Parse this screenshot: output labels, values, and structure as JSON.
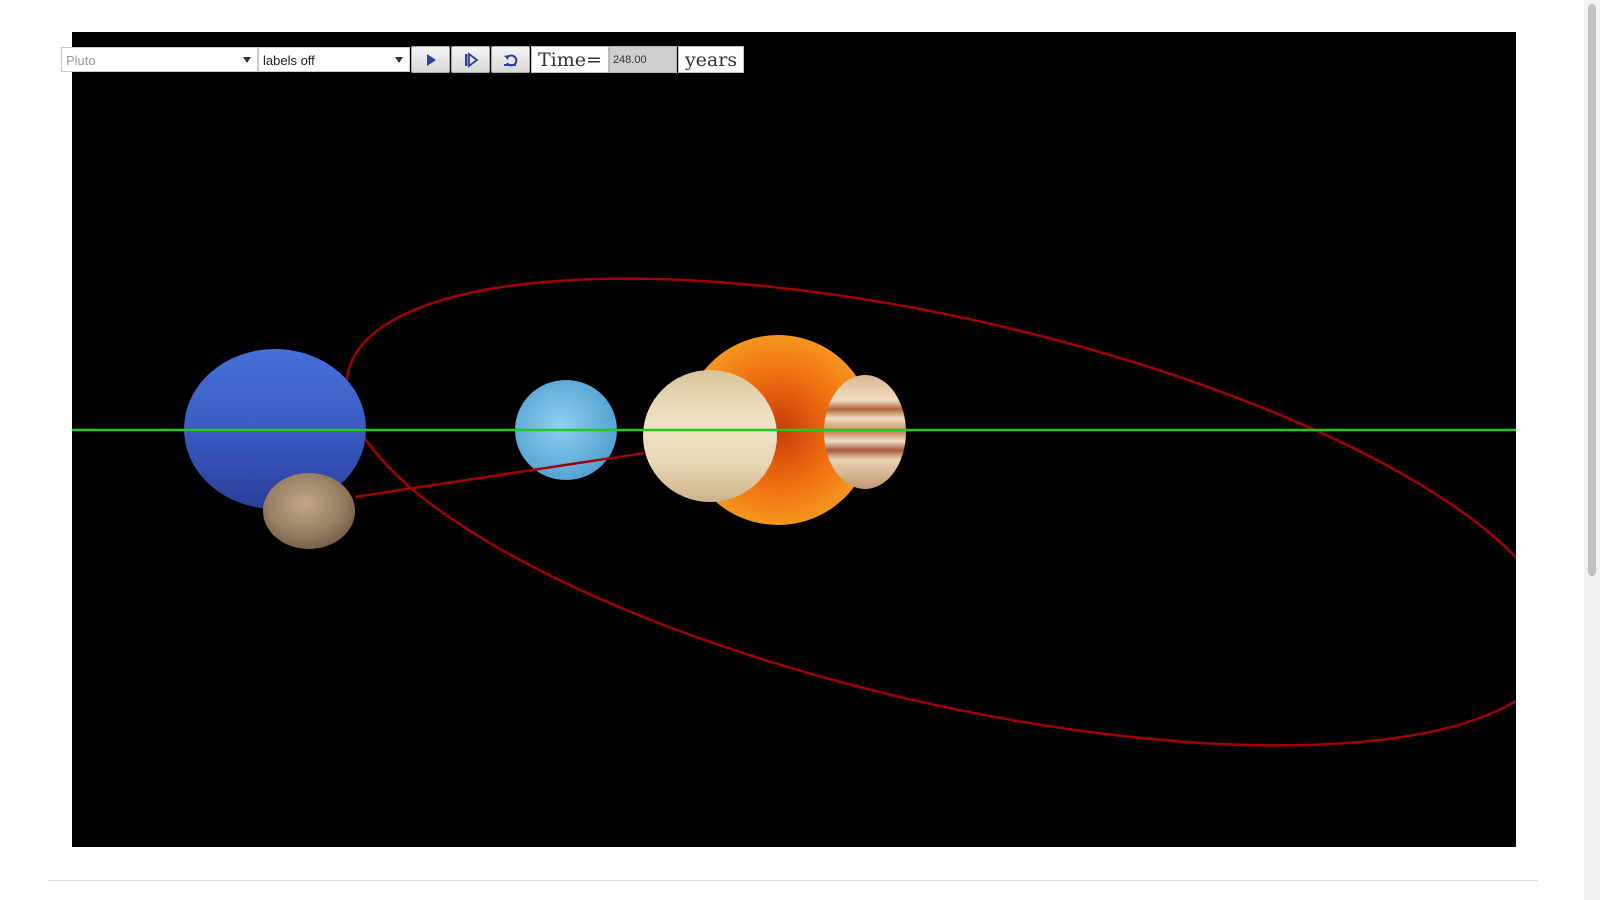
{
  "toolbar": {
    "body_select": {
      "value": "Pluto"
    },
    "labels_select": {
      "value": "labels off"
    },
    "play_button": {
      "icon": "play-icon"
    },
    "step_button": {
      "icon": "step-forward-icon"
    },
    "reset_button": {
      "icon": "reset-icon"
    },
    "time_label": "Time=",
    "time_value": "248.00",
    "time_unit": "years"
  },
  "scene": {
    "background": "#000000",
    "colors": {
      "ecliptic_line": "#22c81e",
      "pluto_orbit": "#a00000",
      "sun": "#f06a0a",
      "neptune": "#3d5fc8",
      "uranus": "#6bbde6",
      "saturn": "#e6d6b2",
      "jupiter": "#c8905a",
      "pluto": "#9a8064"
    },
    "bodies": [
      "sun",
      "neptune",
      "uranus",
      "saturn",
      "jupiter",
      "pluto"
    ]
  }
}
